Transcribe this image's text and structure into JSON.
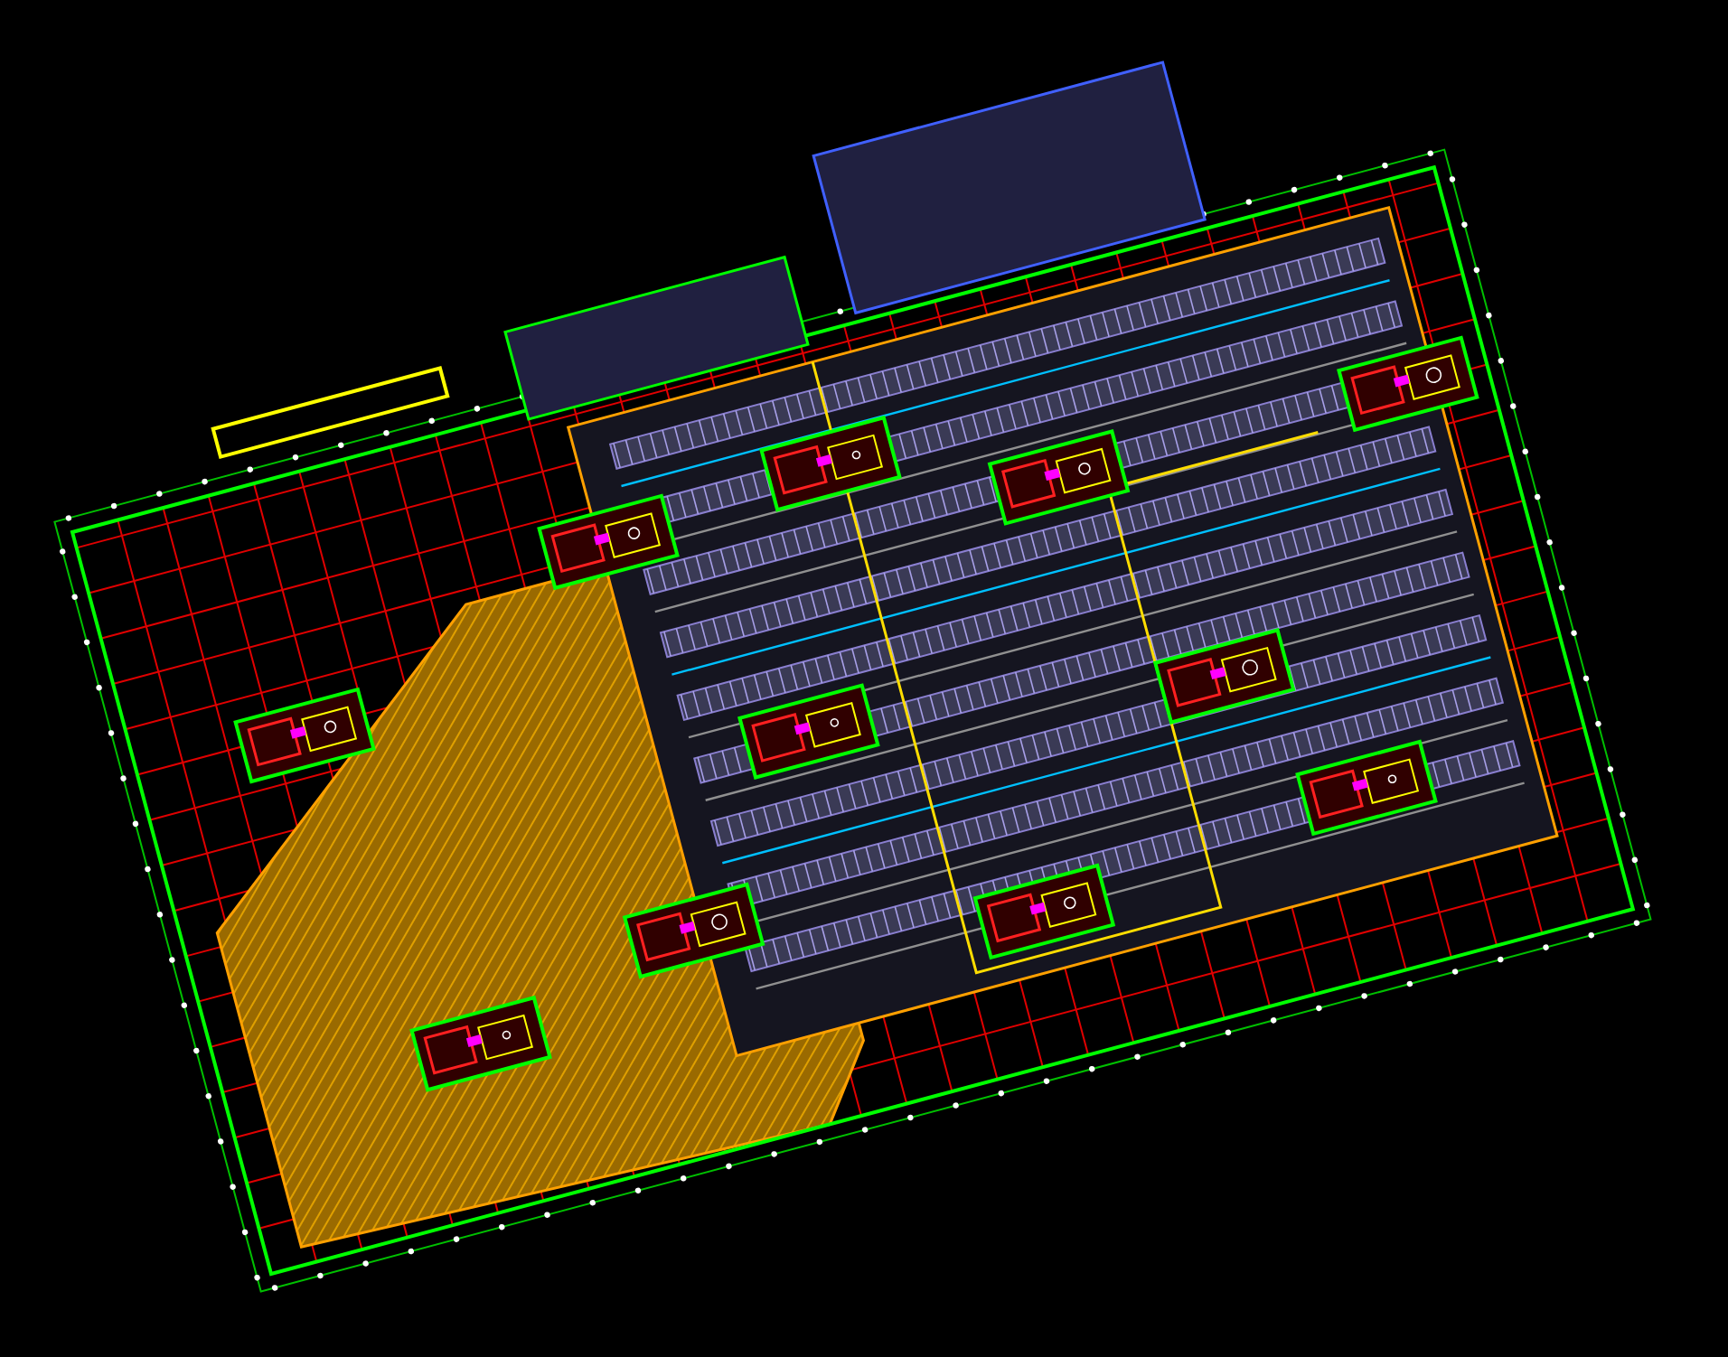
{
  "drawing": {
    "kind": "site-plan"
  }
}
